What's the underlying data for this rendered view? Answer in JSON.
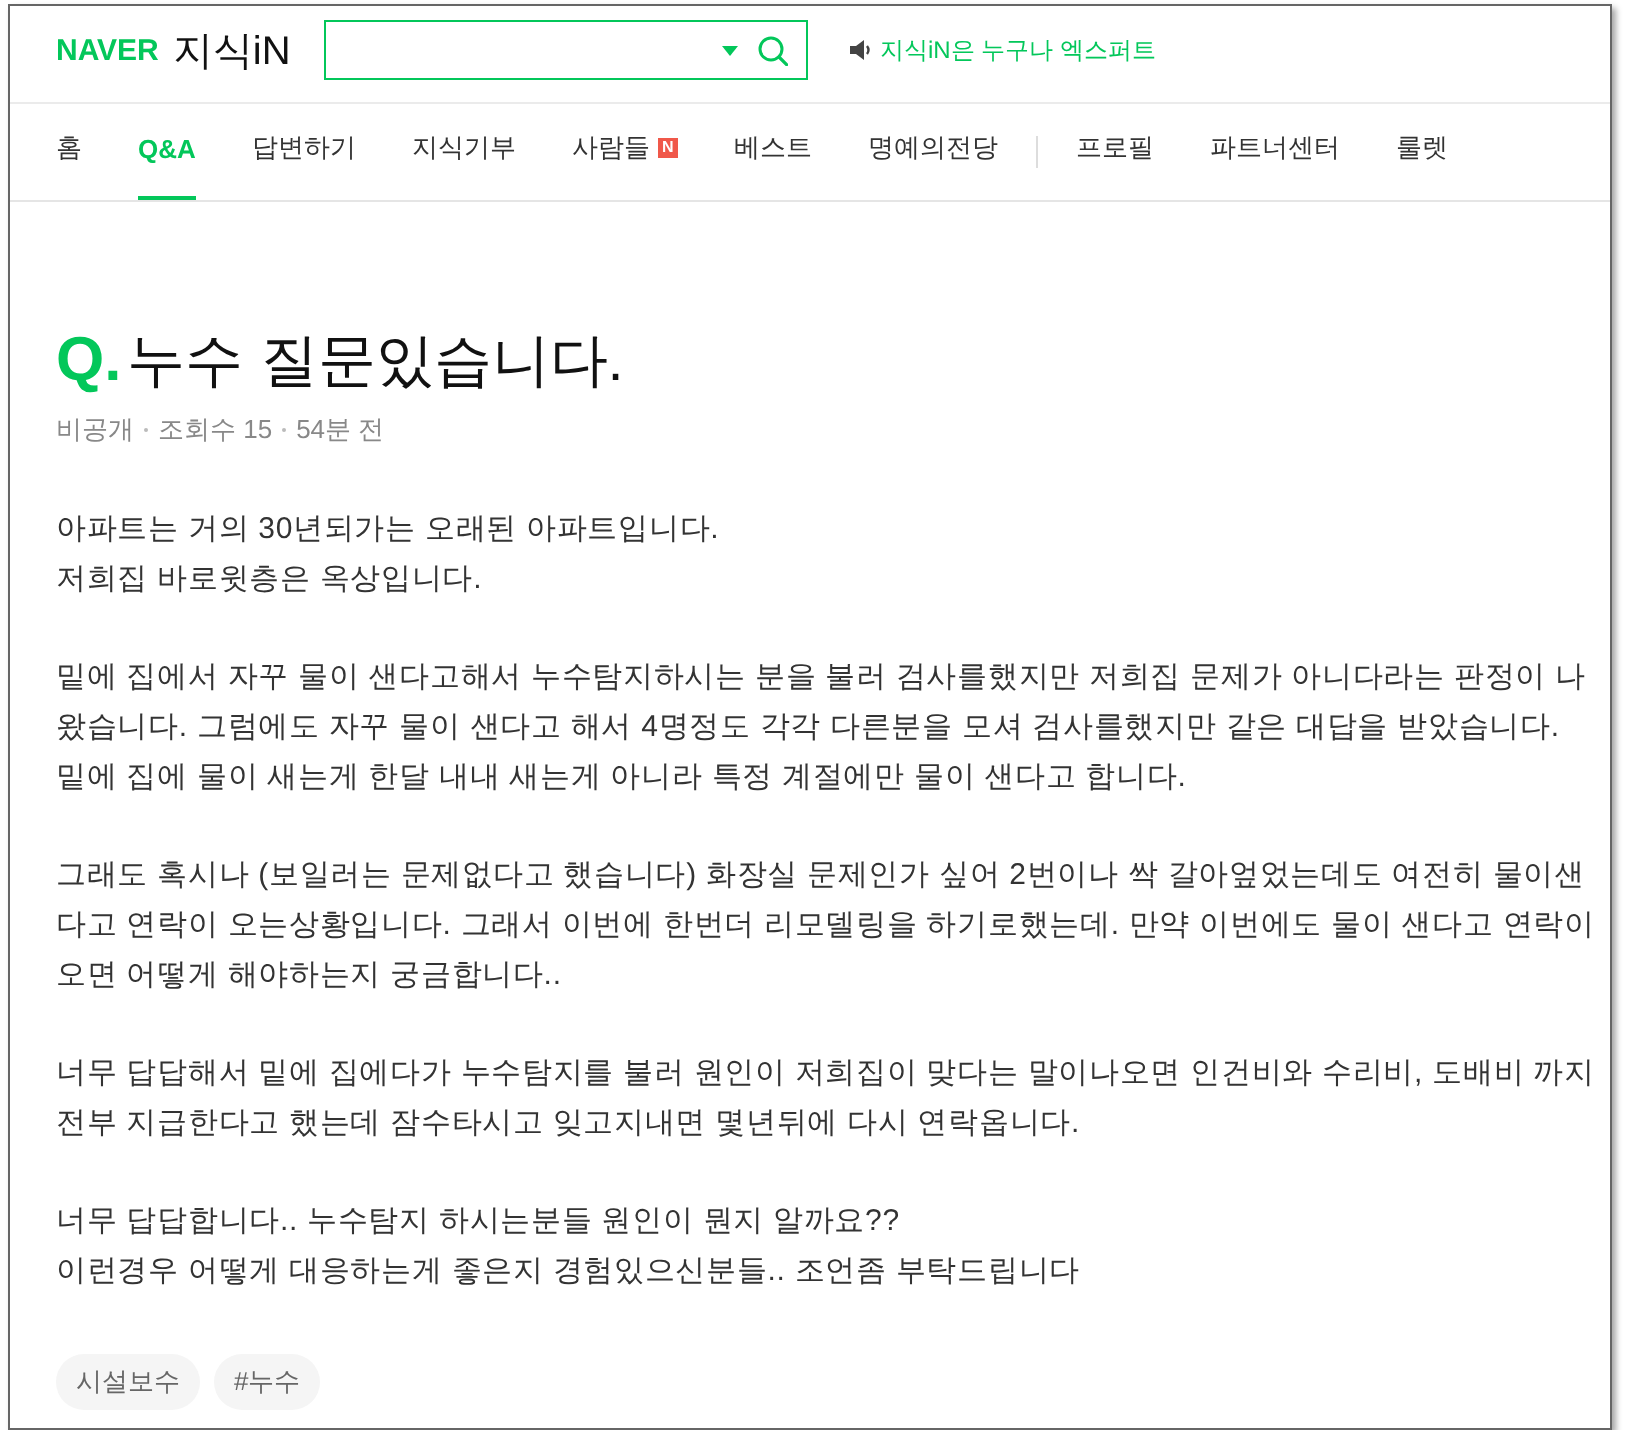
{
  "header": {
    "logo": {
      "brand": "NAVER",
      "product": "지식iN"
    },
    "notice": "지식iN은 누구나 엑스퍼트"
  },
  "nav": {
    "main": [
      {
        "label": "홈",
        "selected": false
      },
      {
        "label": "Q&A",
        "selected": true
      },
      {
        "label": "답변하기",
        "selected": false
      },
      {
        "label": "지식기부",
        "selected": false
      },
      {
        "label": "사람들",
        "selected": false,
        "badge": "N"
      },
      {
        "label": "베스트",
        "selected": false
      },
      {
        "label": "명예의전당",
        "selected": false
      }
    ],
    "extra": [
      {
        "label": "프로필",
        "selected": false
      },
      {
        "label": "파트너센터",
        "selected": false
      },
      {
        "label": "룰렛",
        "selected": false
      }
    ]
  },
  "question": {
    "marker": "Q.",
    "title": "누수 질문있습니다.",
    "meta": [
      "비공개",
      "조회수 15",
      "54분 전"
    ],
    "paragraphs": [
      [
        "아파트는 거의 30년되가는 오래된 아파트입니다.",
        "저희집 바로윗층은 옥상입니다."
      ],
      [
        "밑에 집에서 자꾸 물이 샌다고해서 누수탐지하시는 분을 불러 검사를했지만 저희집 문제가 아니다라는 판정이 나왔습니다. 그럼에도 자꾸 물이 샌다고 해서 4명정도 각각 다른분을 모셔 검사를했지만 같은 대답을 받았습니다.",
        "밑에 집에 물이 새는게 한달 내내 새는게 아니라 특정 계절에만 물이 샌다고 합니다."
      ],
      [
        "그래도 혹시나 (보일러는 문제없다고 했습니다) 화장실 문제인가 싶어 2번이나 싹 갈아엎었는데도 여전히 물이샌다고 연락이 오는상황입니다. 그래서 이번에 한번더 리모델링을 하기로했는데. 만약 이번에도 물이 샌다고 연락이오면 어떻게 해야하는지 궁금합니다.."
      ],
      [
        "너무 답답해서 밑에 집에다가 누수탐지를 불러 원인이 저희집이 맞다는 말이나오면 인건비와 수리비, 도배비 까지 전부 지급한다고 했는데 잠수타시고 잊고지내면 몇년뒤에 다시 연락옵니다."
      ],
      [
        "너무 답답합니다.. 누수탐지 하시는분들 원인이 뭔지 알까요??",
        "이런경우 어떻게 대응하는게 좋은지 경험있으신분들.. 조언좀 부탁드립니다"
      ]
    ],
    "tags": [
      "시설보수",
      "#누수"
    ]
  }
}
